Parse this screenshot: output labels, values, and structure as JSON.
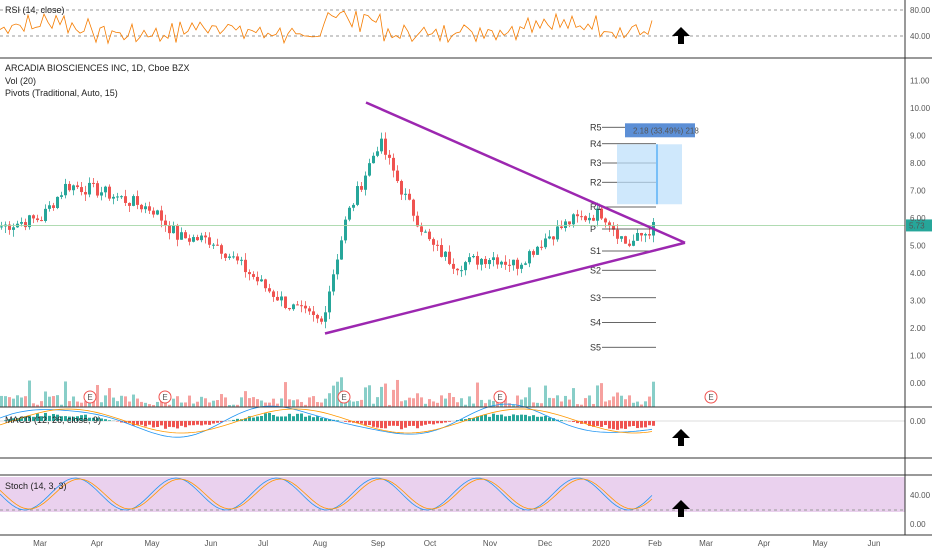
{
  "chart_data": {
    "type": "candlestick",
    "symbol_title": "ARCADIA BIOSCIENCES INC, 1D, Cboe BZX",
    "indicators": {
      "vol": "Vol (20)",
      "pivots": "Pivots (Traditional, Auto, 15)",
      "rsi": "RSI (14, close)",
      "macd": "MACD (12, 26, close, 9)",
      "stoch": "Stoch (14, 3, 3)"
    },
    "price_axis": {
      "min": 0,
      "max": 11,
      "ticks": [
        "11.00",
        "10.00",
        "9.00",
        "8.00",
        "7.00",
        "6.00",
        "5.00",
        "4.00",
        "3.00",
        "2.00",
        "1.00",
        "0.00"
      ]
    },
    "rsi_axis": {
      "ticks": [
        "80.00",
        "40.00"
      ]
    },
    "macd_axis": {
      "ticks": [
        "0.00"
      ]
    },
    "stoch_axis": {
      "ticks": [
        "40.00",
        "0.00"
      ]
    },
    "x_labels": [
      "Mar",
      "Apr",
      "May",
      "Jun",
      "Jul",
      "Aug",
      "Sep",
      "Oct",
      "Nov",
      "Dec",
      "2020",
      "Feb",
      "Mar",
      "Apr",
      "May",
      "Jun"
    ],
    "current_price": "5.73",
    "current_price_level": 5.73,
    "pivot_levels": [
      {
        "name": "R5",
        "value": 9.3
      },
      {
        "name": "R4",
        "value": 8.7
      },
      {
        "name": "R3",
        "value": 8.0
      },
      {
        "name": "R2",
        "value": 7.3
      },
      {
        "name": "R1",
        "value": 6.4
      },
      {
        "name": "P",
        "value": 5.6
      },
      {
        "name": "S1",
        "value": 4.8
      },
      {
        "name": "S2",
        "value": 4.1
      },
      {
        "name": "S3",
        "value": 3.1
      },
      {
        "name": "S4",
        "value": 2.2
      },
      {
        "name": "S5",
        "value": 1.3
      }
    ],
    "measure_label": "2.18 (33.49%) 218",
    "measure_range": [
      6.5,
      8.68
    ],
    "triangle": {
      "upper": [
        {
          "month": "Sep",
          "value": 10.2
        },
        {
          "month": "Feb",
          "value": 5.1
        }
      ],
      "lower": [
        {
          "month": "Aug",
          "value": 1.8
        },
        {
          "month": "Feb",
          "value": 5.1
        }
      ]
    },
    "earnings_marker": "E",
    "earnings_months": [
      "Apr",
      "May",
      "Aug",
      "Nov",
      "Mar"
    ],
    "price_series": [
      {
        "month": "Mar",
        "value": 6.0
      },
      {
        "month": "Mar",
        "value": 7.2
      },
      {
        "month": "Apr",
        "value": 7.0
      },
      {
        "month": "May",
        "value": 6.3
      },
      {
        "month": "May",
        "value": 5.3
      },
      {
        "month": "Jun",
        "value": 5.2
      },
      {
        "month": "Jul",
        "value": 3.5
      },
      {
        "month": "Jul",
        "value": 2.8
      },
      {
        "month": "Aug",
        "value": 2.2
      },
      {
        "month": "Aug",
        "value": 6.0
      },
      {
        "month": "Sep",
        "value": 8.8
      },
      {
        "month": "Sep",
        "value": 6.8
      },
      {
        "month": "Oct",
        "value": 5.0
      },
      {
        "month": "Oct",
        "value": 4.3
      },
      {
        "month": "Nov",
        "value": 4.6
      },
      {
        "month": "Nov",
        "value": 4.3
      },
      {
        "month": "Dec",
        "value": 5.3
      },
      {
        "month": "Dec",
        "value": 5.9
      },
      {
        "month": "2020",
        "value": 6.2
      },
      {
        "month": "2020",
        "value": 5.0
      },
      {
        "month": "Feb",
        "value": 5.73
      }
    ],
    "colors": {
      "up": "#26a69a",
      "down": "#ef5350",
      "triangle": "#9c27b0",
      "rsi": "#f57c00",
      "stoch_band": "#e1bee7",
      "price_tag": "#26a69a",
      "measure": "#2196f3",
      "arrow": "#000000"
    }
  }
}
